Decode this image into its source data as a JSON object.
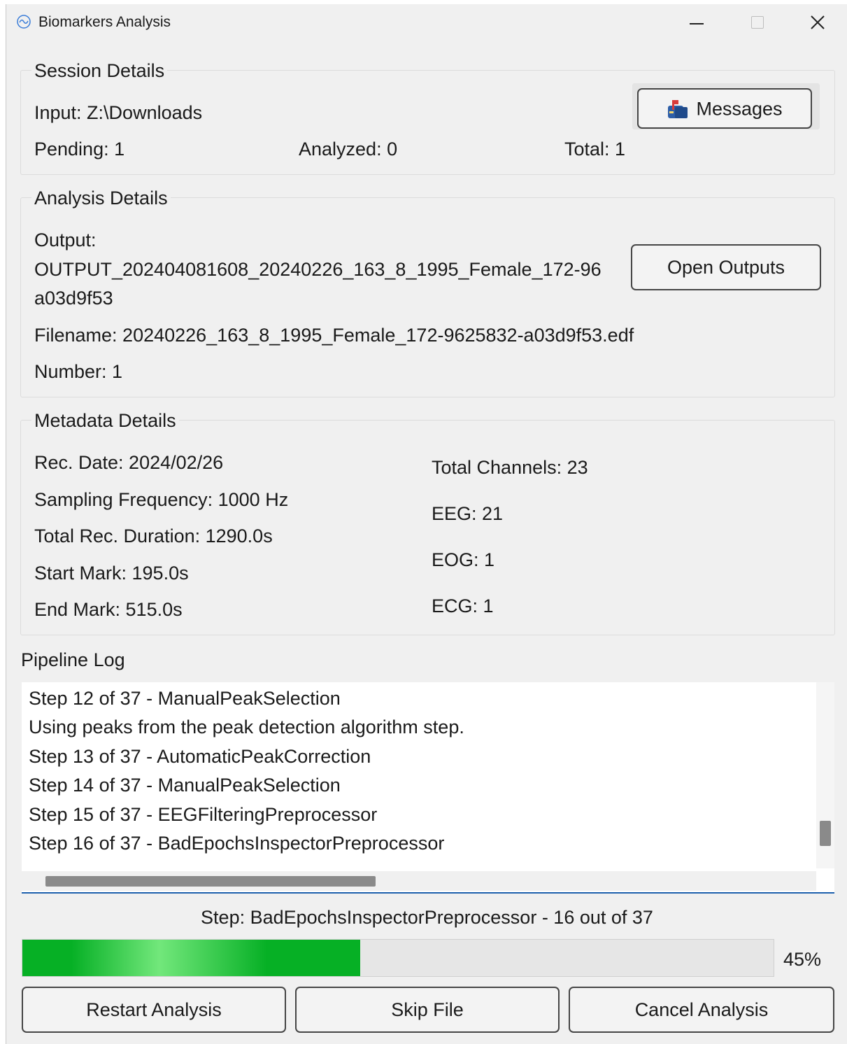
{
  "window": {
    "title": "Biomarkers Analysis"
  },
  "session": {
    "group_title": "Session Details",
    "input": "Input: Z:\\Downloads",
    "pending": "Pending: 1",
    "analyzed": "Analyzed: 0",
    "total": "Total: 1",
    "messages_button": "Messages"
  },
  "analysis": {
    "group_title": "Analysis Details",
    "output_label": "Output:",
    "output_line1": "OUTPUT_202404081608_20240226_163_8_1995_Female_172-96",
    "output_line2": "a03d9f53",
    "filename": "Filename: 20240226_163_8_1995_Female_172-9625832-a03d9f53.edf",
    "number": "Number: 1",
    "open_outputs_button": "Open Outputs"
  },
  "metadata": {
    "group_title": "Metadata Details",
    "rec_date": "Rec. Date: 2024/02/26",
    "sampling_frequency": "Sampling Frequency: 1000 Hz",
    "total_duration": "Total Rec. Duration: 1290.0s",
    "start_mark": "Start Mark: 195.0s",
    "end_mark": "End Mark: 515.0s",
    "total_channels": "Total Channels: 23",
    "eeg": "EEG: 21",
    "eog": "EOG: 1",
    "ecg": "ECG: 1"
  },
  "log": {
    "title": "Pipeline Log",
    "lines": [
      "Step 12 of 37 - ManualPeakSelection",
      "Using peaks from the peak detection algorithm step.",
      "Step 13 of 37 - AutomaticPeakCorrection",
      "Step 14 of 37 - ManualPeakSelection",
      "Step 15 of 37 - EEGFilteringPreprocessor",
      "Step 16 of 37 - BadEpochsInspectorPreprocessor"
    ]
  },
  "progress": {
    "step_text": "Step: BadEpochsInspectorPreprocessor - 16 out of 37",
    "percent_value": 45,
    "percent_text": "45%",
    "fill_color": "#06b025"
  },
  "buttons": {
    "restart": "Restart Analysis",
    "skip": "Skip File",
    "cancel": "Cancel Analysis"
  },
  "icons": {
    "app": "app-logo-icon",
    "messages": "mailbox-icon"
  }
}
